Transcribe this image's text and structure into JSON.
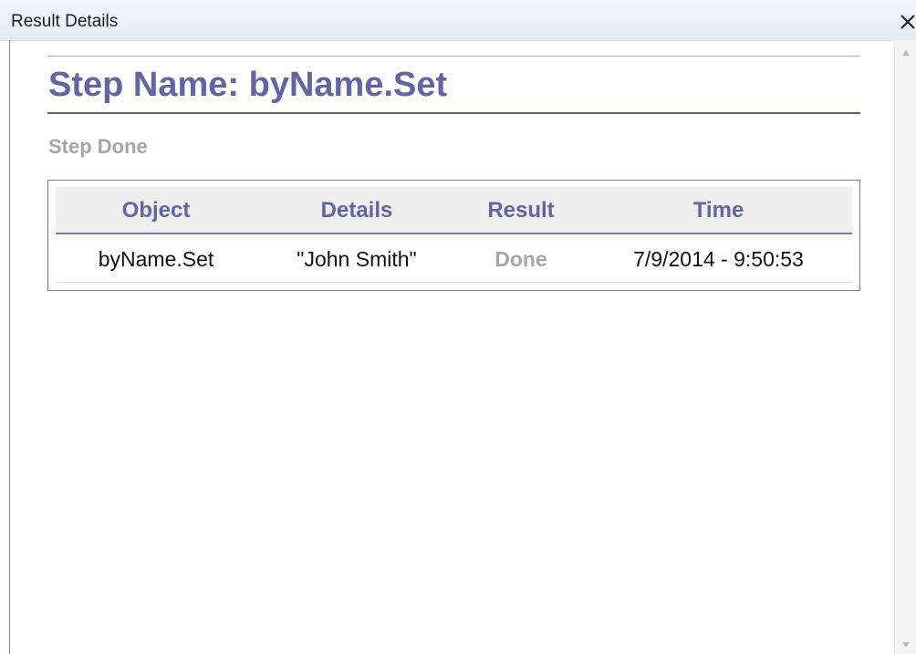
{
  "window": {
    "title": "Result Details",
    "close_label": "✕"
  },
  "report": {
    "step_title": "Step Name: byName.Set",
    "step_status": "Step Done",
    "table": {
      "headers": [
        "Object",
        "Details",
        "Result",
        "Time"
      ],
      "rows": [
        {
          "object": "byName.Set",
          "details": "\"John Smith\"",
          "result": "Done",
          "time": "7/9/2014 - 9:50:53"
        }
      ]
    }
  },
  "colors": {
    "accent": "#6464a2",
    "muted": "#a6a6a6"
  },
  "icons": {
    "close": "close-icon",
    "scroll_up": "scroll-up-arrow-icon",
    "scroll_down": "scroll-down-arrow-icon"
  }
}
